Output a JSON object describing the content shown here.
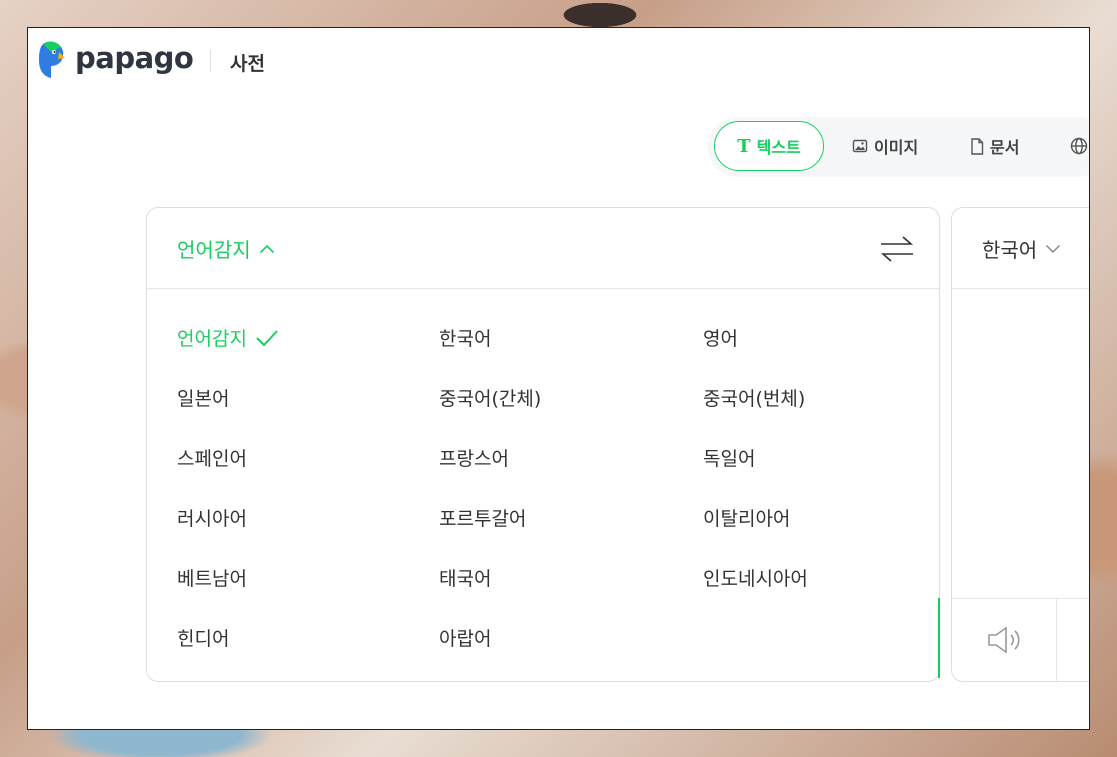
{
  "brand": {
    "name": "papago",
    "dictionary_link": "사전"
  },
  "tabs": [
    {
      "label": "텍스트",
      "icon": "text-T-icon",
      "active": true
    },
    {
      "label": "이미지",
      "icon": "image-icon"
    },
    {
      "label": "문서",
      "icon": "document-icon"
    },
    {
      "label": "",
      "icon": "globe-icon"
    }
  ],
  "source": {
    "selected_language": "언어감지",
    "languages": [
      "언어감지",
      "한국어",
      "영어",
      "일본어",
      "중국어(간체)",
      "중국어(번체)",
      "스페인어",
      "프랑스어",
      "독일어",
      "러시아어",
      "포르투갈어",
      "이탈리아어",
      "베트남어",
      "태국어",
      "인도네시아어",
      "힌디어",
      "아랍어"
    ]
  },
  "target": {
    "selected_language": "한국어"
  },
  "colors": {
    "accent": "#19ce60",
    "text": "#333333",
    "border": "#dedede"
  }
}
